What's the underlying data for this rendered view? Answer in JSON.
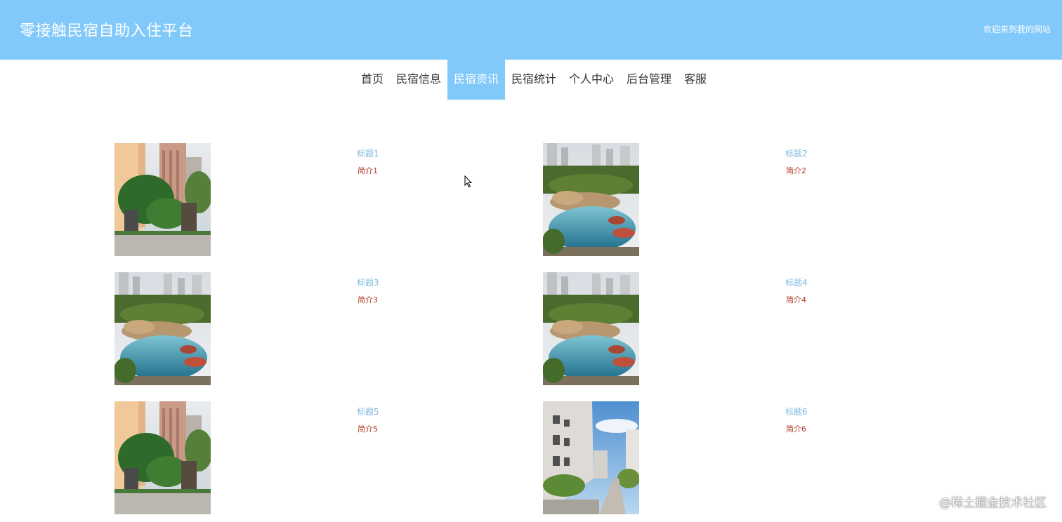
{
  "header": {
    "title": "零接触民宿自助入住平台",
    "welcome": "欢迎来到我的网站"
  },
  "nav": {
    "items": [
      {
        "label": "首页"
      },
      {
        "label": "民宿信息"
      },
      {
        "label": "民宿资讯"
      },
      {
        "label": "民宿统计"
      },
      {
        "label": "个人中心"
      },
      {
        "label": "后台管理"
      },
      {
        "label": "客服"
      }
    ],
    "active": "民宿资讯"
  },
  "news": [
    {
      "title": "标题1",
      "summary": "简介1",
      "image": "gate-tower-photo"
    },
    {
      "title": "标题2",
      "summary": "简介2",
      "image": "garden-pond-photo"
    },
    {
      "title": "标题3",
      "summary": "简介3",
      "image": "garden-pond-photo"
    },
    {
      "title": "标题4",
      "summary": "简介4",
      "image": "garden-pond-photo"
    },
    {
      "title": "标题5",
      "summary": "简介5",
      "image": "gate-tower-photo"
    },
    {
      "title": "标题6",
      "summary": "简介6",
      "image": "apartment-walkway-photo"
    }
  ],
  "watermark": "@稀土掘金技术社区",
  "colors": {
    "primary": "#81c9fa",
    "title_link": "#7fb9de",
    "summary_text": "#b03a24"
  }
}
